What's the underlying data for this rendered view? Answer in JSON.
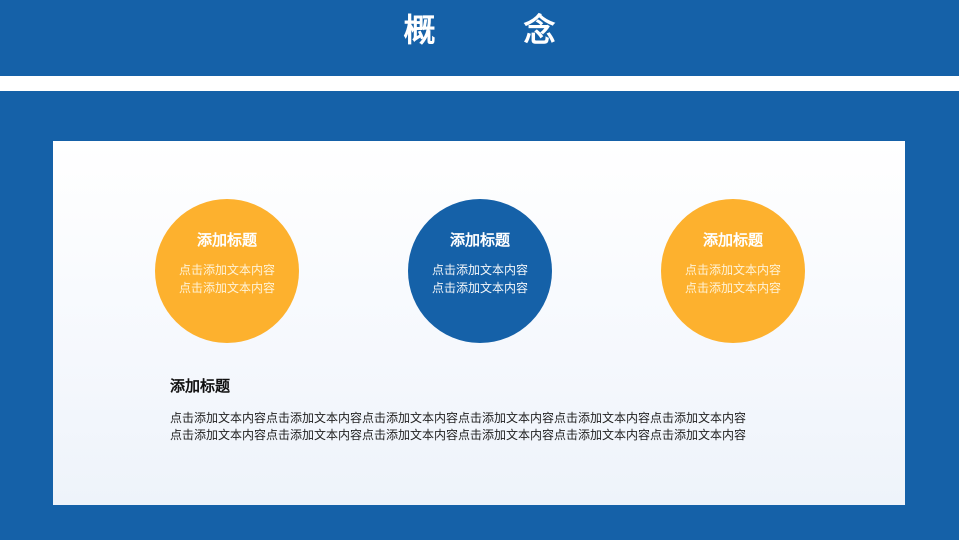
{
  "header": {
    "title": "概念"
  },
  "circles": [
    {
      "title": "添加标题",
      "text": "点击添加文本内容\n点击添加文本内容",
      "color": "#fdb12e"
    },
    {
      "title": "添加标题",
      "text": "点击添加文本内容\n点击添加文本内容",
      "color": "#1561a8"
    },
    {
      "title": "添加标题",
      "text": "点击添加文本内容\n点击添加文本内容",
      "color": "#fdb12e"
    }
  ],
  "section": {
    "title": "添加标题",
    "body": "点击添加文本内容点击添加文本内容点击添加文本内容点击添加文本内容点击添加文本内容点击添加文本内容\n点击添加文本内容点击添加文本内容点击添加文本内容点击添加文本内容点击添加文本内容点击添加文本内容"
  },
  "colors": {
    "primary": "#1561a8",
    "accent": "#fdb12e",
    "background": "#ffffff"
  }
}
